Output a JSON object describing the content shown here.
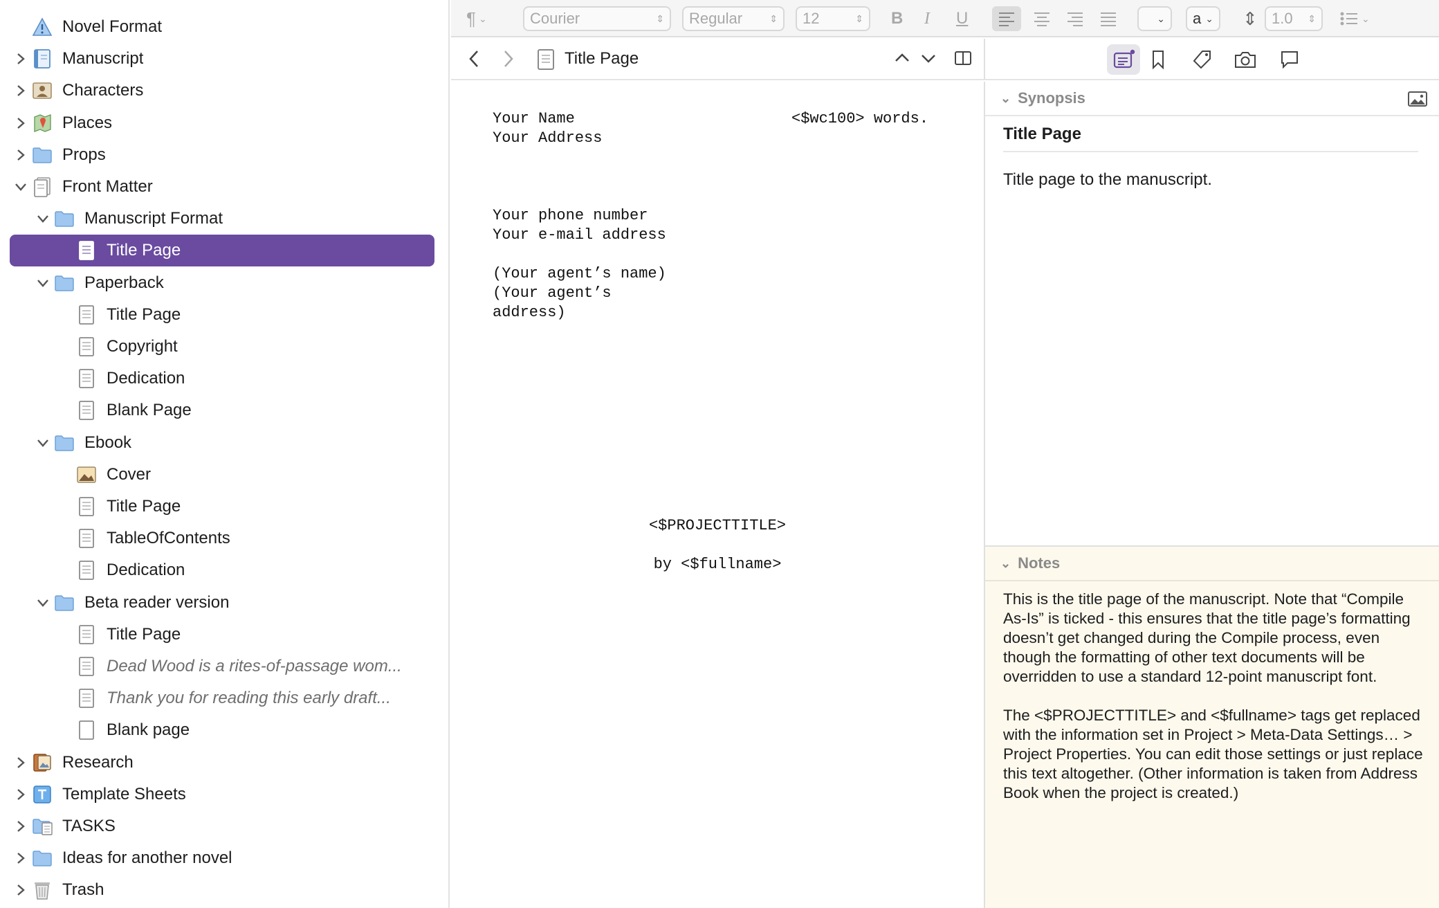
{
  "binder": {
    "items": [
      {
        "label": "Novel Format",
        "level": 0,
        "disc": "none",
        "icon": "warning",
        "italic": false,
        "selected": false
      },
      {
        "label": "Manuscript",
        "level": 0,
        "disc": "right",
        "icon": "manuscript",
        "italic": false,
        "selected": false
      },
      {
        "label": "Characters",
        "level": 0,
        "disc": "right",
        "icon": "character",
        "italic": false,
        "selected": false
      },
      {
        "label": "Places",
        "level": 0,
        "disc": "right",
        "icon": "places",
        "italic": false,
        "selected": false
      },
      {
        "label": "Props",
        "level": 0,
        "disc": "right",
        "icon": "folder",
        "italic": false,
        "selected": false
      },
      {
        "label": "Front Matter",
        "level": 0,
        "disc": "down",
        "icon": "frontmatter",
        "italic": false,
        "selected": false
      },
      {
        "label": "Manuscript Format",
        "level": 1,
        "disc": "down",
        "icon": "folder",
        "italic": false,
        "selected": false
      },
      {
        "label": "Title Page",
        "level": 2,
        "disc": "none",
        "icon": "doc",
        "italic": false,
        "selected": true
      },
      {
        "label": "Paperback",
        "level": 1,
        "disc": "down",
        "icon": "folder",
        "italic": false,
        "selected": false
      },
      {
        "label": "Title Page",
        "level": 2,
        "disc": "none",
        "icon": "doc",
        "italic": false,
        "selected": false
      },
      {
        "label": "Copyright",
        "level": 2,
        "disc": "none",
        "icon": "doc",
        "italic": false,
        "selected": false
      },
      {
        "label": "Dedication",
        "level": 2,
        "disc": "none",
        "icon": "doc",
        "italic": false,
        "selected": false
      },
      {
        "label": "Blank Page",
        "level": 2,
        "disc": "none",
        "icon": "doc",
        "italic": false,
        "selected": false
      },
      {
        "label": "Ebook",
        "level": 1,
        "disc": "down",
        "icon": "folder",
        "italic": false,
        "selected": false
      },
      {
        "label": "Cover",
        "level": 2,
        "disc": "none",
        "icon": "image",
        "italic": false,
        "selected": false
      },
      {
        "label": "Title Page",
        "level": 2,
        "disc": "none",
        "icon": "doc",
        "italic": false,
        "selected": false
      },
      {
        "label": "TableOfContents",
        "level": 2,
        "disc": "none",
        "icon": "doc",
        "italic": false,
        "selected": false
      },
      {
        "label": "Dedication",
        "level": 2,
        "disc": "none",
        "icon": "doc",
        "italic": false,
        "selected": false
      },
      {
        "label": "Beta reader version",
        "level": 1,
        "disc": "down",
        "icon": "folder",
        "italic": false,
        "selected": false
      },
      {
        "label": "Title Page",
        "level": 2,
        "disc": "none",
        "icon": "doc",
        "italic": false,
        "selected": false
      },
      {
        "label": "Dead Wood is a rites-of-passage wom...",
        "level": 2,
        "disc": "none",
        "icon": "doc",
        "italic": true,
        "selected": false
      },
      {
        "label": "Thank you for reading this early draft...",
        "level": 2,
        "disc": "none",
        "icon": "doc",
        "italic": true,
        "selected": false
      },
      {
        "label": "Blank page",
        "level": 2,
        "disc": "none",
        "icon": "blank",
        "italic": false,
        "selected": false
      },
      {
        "label": "Research",
        "level": 0,
        "disc": "right",
        "icon": "research",
        "italic": false,
        "selected": false
      },
      {
        "label": "Template Sheets",
        "level": 0,
        "disc": "right",
        "icon": "template",
        "italic": false,
        "selected": false
      },
      {
        "label": "TASKS",
        "level": 0,
        "disc": "right",
        "icon": "docfolder",
        "italic": false,
        "selected": false
      },
      {
        "label": "Ideas for another novel",
        "level": 0,
        "disc": "right",
        "icon": "folder",
        "italic": false,
        "selected": false
      },
      {
        "label": "Trash",
        "level": 0,
        "disc": "right",
        "icon": "trash",
        "italic": false,
        "selected": false
      }
    ]
  },
  "formatbar": {
    "font_family": "Courier",
    "font_style": "Regular",
    "font_size": "12",
    "bold": "B",
    "italic": "I",
    "underline": "U",
    "highlight": "a",
    "line_spacing": "1.0"
  },
  "editor": {
    "doc_title": "Title Page",
    "text": {
      "top_left": "Your Name\nYour Address",
      "top_right": "<$wc100> words.",
      "contact": "Your phone number\nYour e-mail address\n\n(Your agent’s name)\n(Your agent’s\naddress)",
      "project_title": "<$PROJECTTITLE>",
      "byline": "by <$fullname>"
    }
  },
  "inspector": {
    "synopsis_header": "Synopsis",
    "synopsis_title": "Title Page",
    "synopsis_text": "Title page to the manuscript.",
    "notes_header": "Notes",
    "notes_p1": "This is the title page of the manuscript. Note that “Compile As-Is” is ticked - this ensures that the title page’s formatting doesn’t get changed during the Compile process, even though the formatting of other text documents will be overridden to use a standard 12-point manuscript font.",
    "notes_p2": "The <$PROJECTTITLE> and <$fullname> tags get replaced with the information set in Project > Meta-Data Settings… > Project Properties. You can edit those settings or just replace this text altogether. (Other information is taken from Address Book when the project is created.)"
  },
  "colors": {
    "selection": "#6a4ba0",
    "folder": "#9fc7f0",
    "notes_bg": "#fdf9ec",
    "inspector_active": "#6a4ba0"
  }
}
